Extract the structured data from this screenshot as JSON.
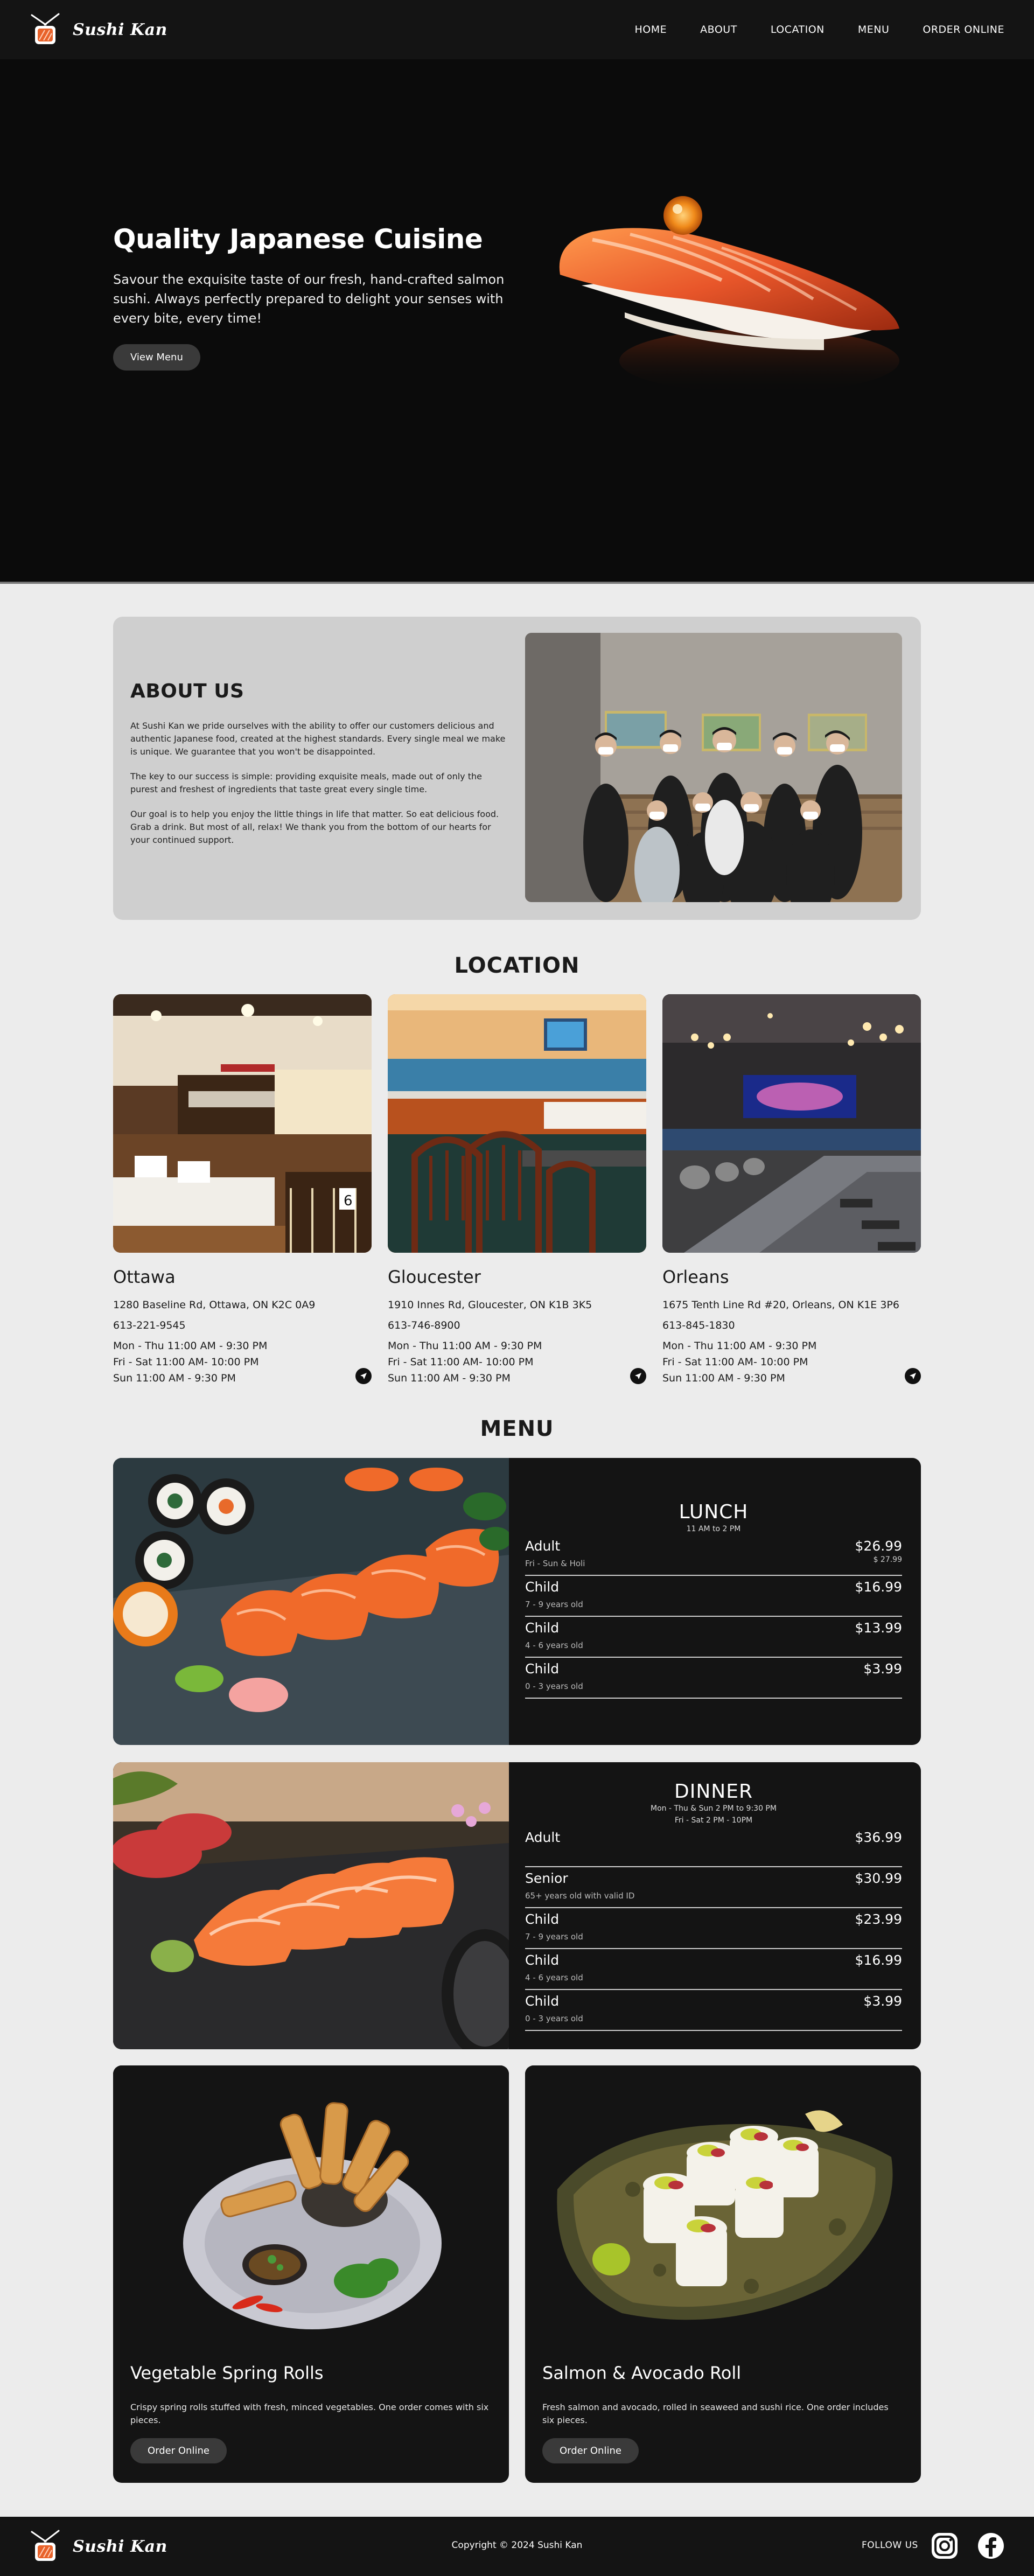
{
  "brand": {
    "name": "Sushi Kan"
  },
  "nav": {
    "links": [
      "HOME",
      "ABOUT",
      "LOCATION",
      "MENU",
      "ORDER ONLINE"
    ]
  },
  "hero": {
    "title": "Quality Japanese Cuisine",
    "subtitle": "Savour the exquisite taste of our fresh, hand-crafted salmon sushi. Always perfectly prepared to delight your senses with every bite, every time!",
    "cta": "View Menu"
  },
  "about": {
    "title": "ABOUT US",
    "paragraphs": [
      "At Sushi Kan we pride ourselves with the ability to offer our customers delicious and authentic Japanese food, created at the highest standards. Every single meal we make is unique. We guarantee that you won't be disappointed.",
      "The key to our success is simple: providing exquisite meals, made out of only the purest and freshest of ingredients that taste great every single time.",
      "Our goal is to help you enjoy the little things in life that matter. So eat delicious food. Grab a drink. But most of all, relax! We thank you from the bottom of our hearts for your continued support."
    ]
  },
  "location": {
    "title": "LOCATION",
    "stores": [
      {
        "name": "Ottawa",
        "address": "1280 Baseline Rd, Ottawa, ON K2C 0A9",
        "phone": "613-221-9545",
        "hours": [
          "Mon - Thu 11:00 AM - 9:30 PM",
          "Fri - Sat 11:00 AM- 10:00 PM",
          "Sun 11:00 AM - 9:30 PM"
        ]
      },
      {
        "name": "Gloucester",
        "address": "1910 Innes Rd, Gloucester, ON K1B 3K5",
        "phone": "613-746-8900",
        "hours": [
          "Mon - Thu 11:00 AM - 9:30 PM",
          "Fri - Sat 11:00 AM- 10:00 PM",
          "Sun 11:00 AM - 9:30 PM"
        ]
      },
      {
        "name": "Orleans",
        "address": "1675 Tenth Line Rd #20, Orleans, ON K1E 3P6",
        "phone": "613-845-1830",
        "hours": [
          "Mon - Thu 11:00 AM - 9:30 PM",
          "Fri - Sat 11:00 AM- 10:00 PM",
          "Sun 11:00 AM - 9:30 PM"
        ]
      }
    ]
  },
  "menu": {
    "title": "MENU",
    "lunch": {
      "title": "LUNCH",
      "sub": "11 AM to 2 PM",
      "rows": [
        {
          "label": "Adult",
          "note": "Fri - Sun & Holi",
          "price": "$26.99",
          "price2": "$ 27.99"
        },
        {
          "label": "Child",
          "note": "7 - 9 years old",
          "price": "$16.99"
        },
        {
          "label": "Child",
          "note": "4 - 6 years old",
          "price": "$13.99"
        },
        {
          "label": "Child",
          "note": "0 - 3 years old",
          "price": "$3.99"
        }
      ]
    },
    "dinner": {
      "title": "DINNER",
      "sub1": "Mon - Thu & Sun 2 PM to 9:30 PM",
      "sub2": "Fri - Sat 2 PM - 10PM",
      "rows": [
        {
          "label": "Adult",
          "note": "",
          "price": "$36.99"
        },
        {
          "label": "Senior",
          "note": "65+ years old with valid ID",
          "price": "$30.99"
        },
        {
          "label": "Child",
          "note": "7 - 9 years old",
          "price": "$23.99"
        },
        {
          "label": "Child",
          "note": "4 - 6 years old",
          "price": "$16.99"
        },
        {
          "label": "Child",
          "note": "0 - 3 years old",
          "price": "$3.99"
        }
      ]
    }
  },
  "food": [
    {
      "title": "Vegetable Spring Rolls",
      "desc": "Crispy spring rolls stuffed with fresh, minced vegetables. One order comes with six pieces.",
      "cta": "Order Online"
    },
    {
      "title": "Salmon & Avocado Roll",
      "desc": "Fresh salmon and avocado, rolled in seaweed and sushi rice. One order includes six pieces.",
      "cta": "Order Online"
    }
  ],
  "footer": {
    "copyright": "Copyright © 2024 Sushi Kan",
    "follow": "FOLLOW US"
  },
  "icons": {
    "social": [
      "instagram-icon",
      "facebook-icon"
    ],
    "direction": "navigation-arrow-icon"
  },
  "colors": {
    "dark": "#141414",
    "accent_salmon": "#e8622a",
    "page_bg": "#ececec",
    "about_bg": "#cfcfcf"
  }
}
